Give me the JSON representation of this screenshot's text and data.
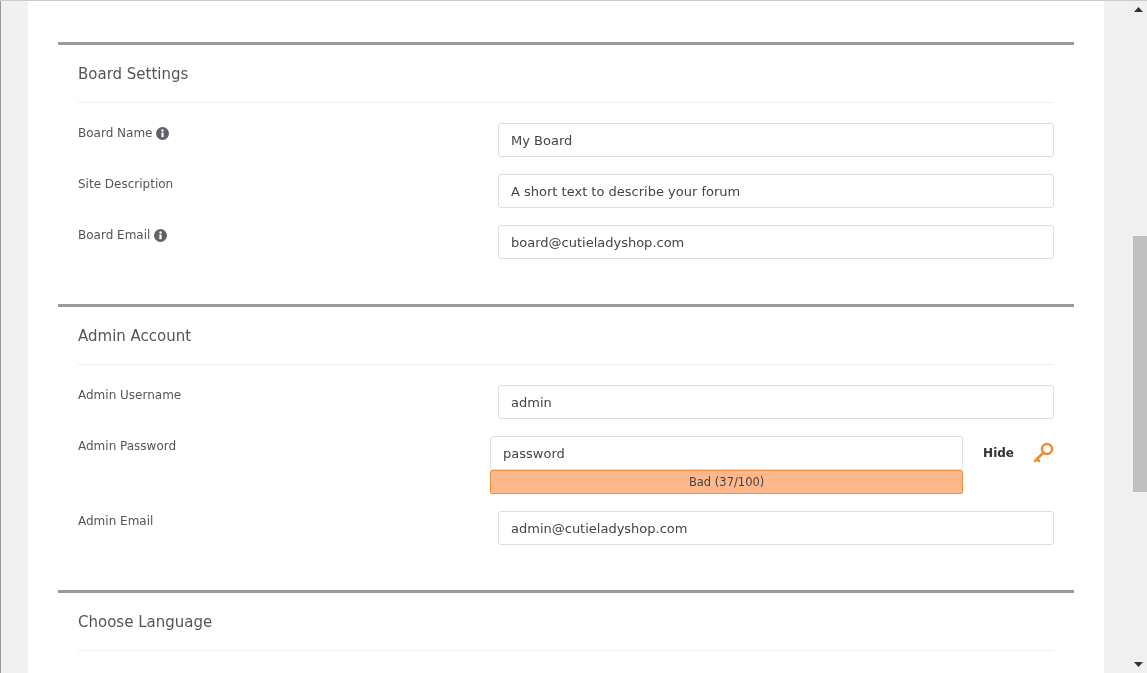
{
  "sections": [
    {
      "title": "Board Settings",
      "fields": [
        {
          "label": "Board Name",
          "info": true,
          "value": "My Board"
        },
        {
          "label": "Site Description",
          "info": false,
          "value": "A short text to describe your forum"
        },
        {
          "label": "Board Email",
          "info": true,
          "value": "board@cutieladyshop.com"
        }
      ]
    },
    {
      "title": "Admin Account",
      "fields": [
        {
          "label": "Admin Username",
          "info": false,
          "value": "admin"
        },
        {
          "label": "Admin Password",
          "info": false,
          "value": "password",
          "toggle": "Hide",
          "strength": "Bad (37/100)"
        },
        {
          "label": "Admin Email",
          "info": false,
          "value": "admin@cutieladyshop.com"
        }
      ]
    },
    {
      "title": "Choose Language"
    }
  ]
}
